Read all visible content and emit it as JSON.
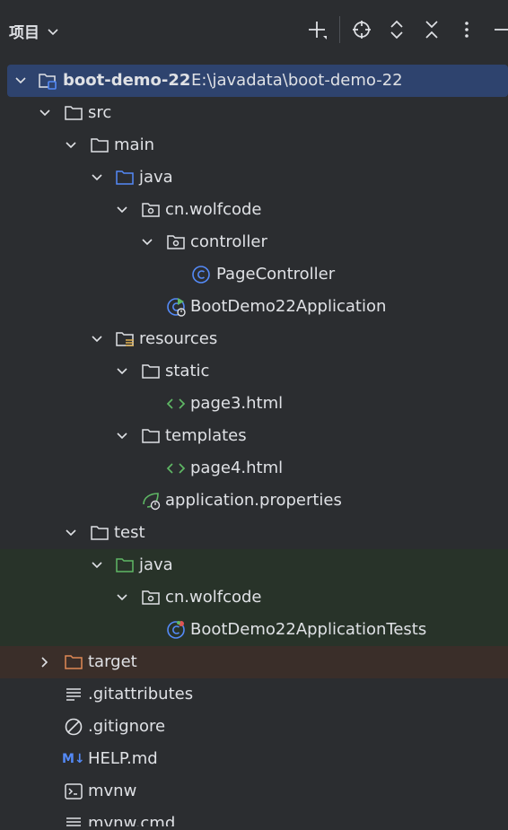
{
  "header": {
    "title": "项目"
  },
  "tree": {
    "root": {
      "name": "boot-demo-22",
      "path": "E:\\javadata\\boot-demo-22"
    },
    "items": [
      {
        "label": "src"
      },
      {
        "label": "main"
      },
      {
        "label": "java"
      },
      {
        "label": "cn.wolfcode"
      },
      {
        "label": "controller"
      },
      {
        "label": "PageController"
      },
      {
        "label": "BootDemo22Application"
      },
      {
        "label": "resources"
      },
      {
        "label": "static"
      },
      {
        "label": "page3.html"
      },
      {
        "label": "templates"
      },
      {
        "label": "page4.html"
      },
      {
        "label": "application.properties"
      },
      {
        "label": "test"
      },
      {
        "label": "java"
      },
      {
        "label": "cn.wolfcode"
      },
      {
        "label": "BootDemo22ApplicationTests"
      },
      {
        "label": "target"
      },
      {
        "label": ".gitattributes"
      },
      {
        "label": ".gitignore"
      },
      {
        "label": "HELP.md"
      },
      {
        "label": "mvnw"
      },
      {
        "label": "mvnw.cmd"
      }
    ],
    "md_badge": "M↓"
  },
  "colors": {
    "background": "#2b2d30",
    "selection": "#2e436e",
    "test_row": "#283329",
    "excluded_row": "#3a2e29",
    "folder_blue": "#548af7",
    "folder_green": "#5fb865",
    "folder_orange": "#e08855",
    "class_blue": "#548af7",
    "html_green": "#5fb865"
  }
}
